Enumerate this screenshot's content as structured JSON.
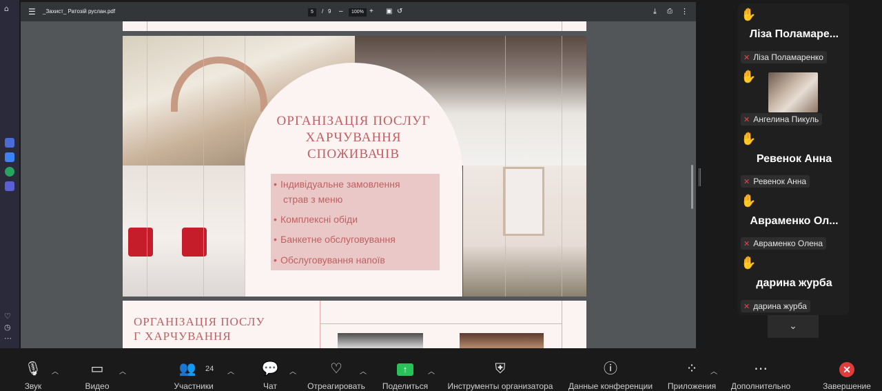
{
  "pdf": {
    "menu_icon": "menu-icon",
    "filename": "_Захист_ Ратозій руслан.pdf",
    "page_current": "5",
    "page_sep": "/",
    "page_total": "9",
    "zoom_out": "–",
    "zoom_level": "100%",
    "zoom_in": "+",
    "fit_icon": "fit-page-icon",
    "rotate_icon": "rotate-icon",
    "download_icon": "download-icon",
    "print_icon": "print-icon",
    "more_icon": "more-vert-icon"
  },
  "slide": {
    "title_line1": "ОРГАНІЗАЦІЯ ПОСЛУГ",
    "title_line2": "ХАРЧУВАННЯ",
    "title_line3": "СПОЖИВАЧІВ",
    "bullet": "•",
    "item1_line1": "Індивідуальне       замовлення",
    "item1_line2": "страв з меню",
    "item2": "Комплексні обіди",
    "item3": "Банкетне обслуговування",
    "item4": "Обслуговування напоїв"
  },
  "slide2": {
    "title_line1": "ОРГАНІЗАЦІЯ ПОСЛУ",
    "title_line2": "Г ХАРЧУВАННЯ"
  },
  "participants": [
    {
      "big_name": "Ліза Поламаре...",
      "small_name": "Ліза Поламаренко",
      "has_video": false
    },
    {
      "big_name": "",
      "small_name": "Ангелина Пикуль",
      "has_video": true
    },
    {
      "big_name": "Ревенок Анна",
      "small_name": "Ревенок Анна",
      "has_video": false
    },
    {
      "big_name": "Авраменко Ол...",
      "small_name": "Авраменко Олена",
      "has_video": false
    },
    {
      "big_name": "дарина журба",
      "small_name": "дарина журба",
      "has_video": false
    }
  ],
  "bottombar": {
    "audio": "Звук",
    "video": "Видео",
    "participants": "Участники",
    "participants_count": "24",
    "chat": "Чат",
    "react": "Отреагировать",
    "share": "Поделиться",
    "host_tools": "Инструменты организатора",
    "meeting_info": "Данные конференции",
    "apps": "Приложения",
    "more": "Дополнительно",
    "end": "Завершение"
  },
  "colors": {
    "slide_accent": "#bf5f60",
    "list_bg": "#eac8c8",
    "share_green": "#29c25a",
    "end_red": "#e03c3c",
    "hand_yellow": "#f6c343"
  }
}
